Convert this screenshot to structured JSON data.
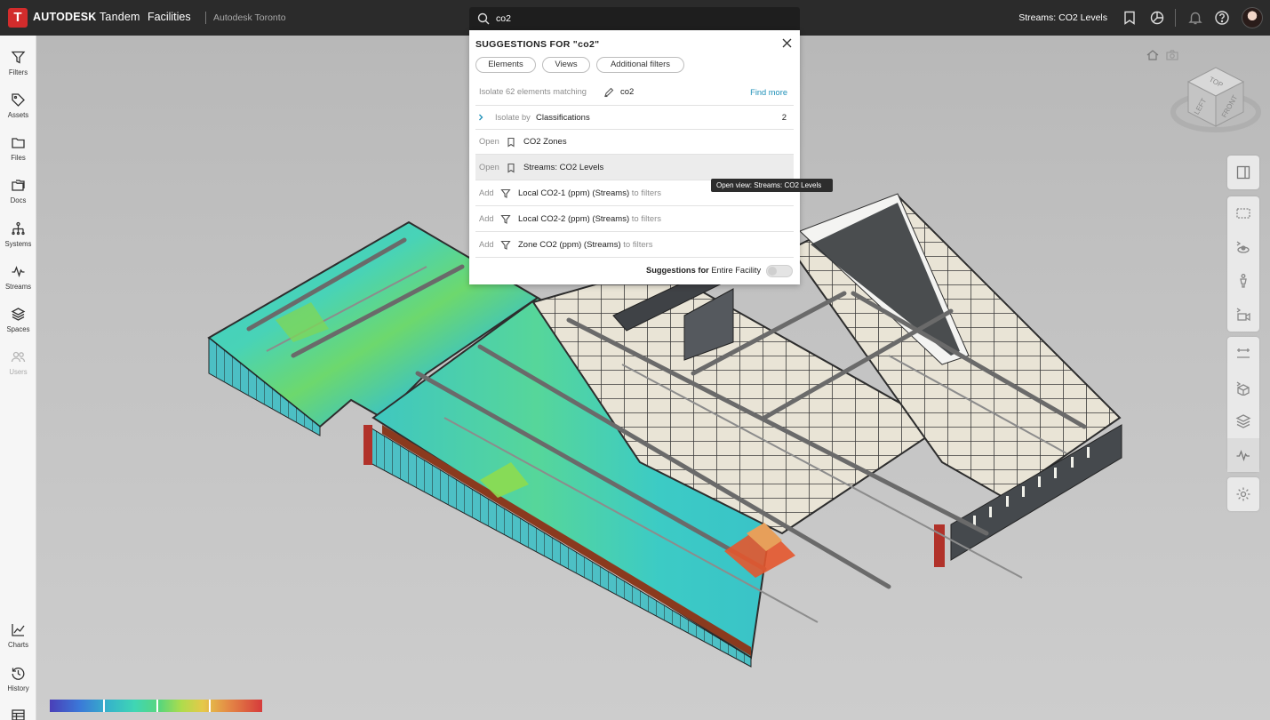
{
  "app": {
    "logo_letter": "T",
    "brand_bold": "AUTODESK",
    "brand_rest": "Tandem",
    "nav_facilities": "Facilities",
    "facility_name": "Autodesk Toronto",
    "current_view": "Streams: CO2 Levels"
  },
  "topbar_icons": [
    "bookmark-icon",
    "dashboard-icon",
    "notification-bell-icon",
    "help-icon",
    "avatar"
  ],
  "sidebar": {
    "items": [
      {
        "label": "Filters",
        "icon": "filter-icon"
      },
      {
        "label": "Assets",
        "icon": "tag-icon"
      },
      {
        "label": "Files",
        "icon": "folder-icon"
      },
      {
        "label": "Docs",
        "icon": "docs-icon"
      },
      {
        "label": "Systems",
        "icon": "systems-icon"
      },
      {
        "label": "Streams",
        "icon": "streams-icon"
      },
      {
        "label": "Spaces",
        "icon": "layers-icon"
      },
      {
        "label": "Users",
        "icon": "users-icon"
      }
    ],
    "bottom_items": [
      {
        "label": "Charts",
        "icon": "chart-icon"
      },
      {
        "label": "History",
        "icon": "history-icon"
      },
      {
        "label": "",
        "icon": "table-icon"
      }
    ]
  },
  "search": {
    "value": "co2",
    "title": "SUGGESTIONS FOR \"co2\"",
    "chips": [
      "Elements",
      "Views",
      "Additional filters"
    ],
    "isolate": {
      "prefix": "Isolate 62 elements matching",
      "term": "co2",
      "link": "Find more"
    },
    "classification": {
      "prefix": "Isolate by",
      "label": "Classifications",
      "count": "2"
    },
    "views": [
      {
        "prefix": "Open",
        "label": "CO2 Zones"
      },
      {
        "prefix": "Open",
        "label": "Streams: CO2 Levels"
      }
    ],
    "filters": [
      {
        "prefix": "Add",
        "label": "Local CO2-1 (ppm) (Streams)",
        "suffix": "to filters"
      },
      {
        "prefix": "Add",
        "label": "Local CO2-2 (ppm) (Streams)",
        "suffix": "to filters"
      },
      {
        "prefix": "Add",
        "label": "Zone CO2 (ppm) (Streams)",
        "suffix": "to filters"
      }
    ],
    "footer_bold": "Suggestions for",
    "footer_rest": "Entire Facility",
    "toggle_on": false
  },
  "tooltip": "Open view: Streams: CO2 Levels",
  "viewcube": {
    "top": "TOP",
    "left": "LEFT",
    "front": "FRONT"
  },
  "colors": {
    "accent": "#1d8fb7",
    "topbar": "#2b2b2b",
    "brand_red": "#d22c2c"
  }
}
